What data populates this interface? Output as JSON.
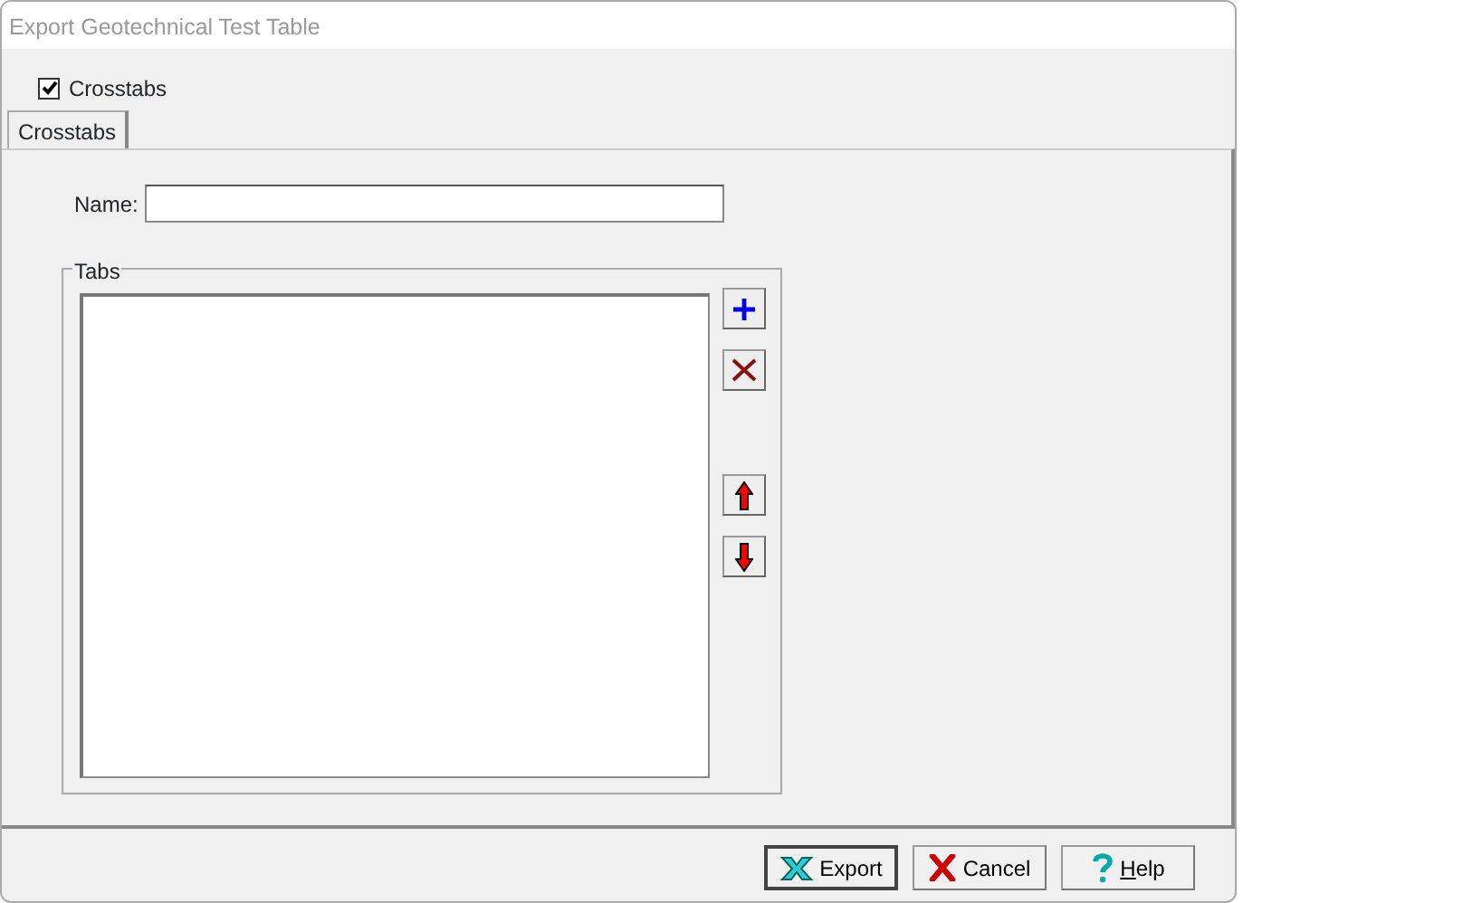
{
  "window": {
    "title": "Export Geotechnical Test Table"
  },
  "crosstabs_option": {
    "label": "Crosstabs",
    "checked": true
  },
  "tabs": [
    {
      "label": "Crosstabs",
      "selected": true
    }
  ],
  "name_field": {
    "label": "Name:"
  },
  "tabs_group": {
    "title": "Tabs",
    "side_buttons": [
      {
        "kind": "add"
      },
      {
        "kind": "delete"
      },
      {
        "kind": "gap"
      },
      {
        "kind": "up"
      },
      {
        "kind": "down"
      }
    ]
  },
  "buttons": [
    {
      "kind": "export",
      "label": "Export",
      "default": true
    },
    {
      "kind": "cancel",
      "label": "Cancel",
      "default": false
    },
    {
      "kind": "help",
      "label": "Help",
      "underline_first": true
    }
  ]
}
